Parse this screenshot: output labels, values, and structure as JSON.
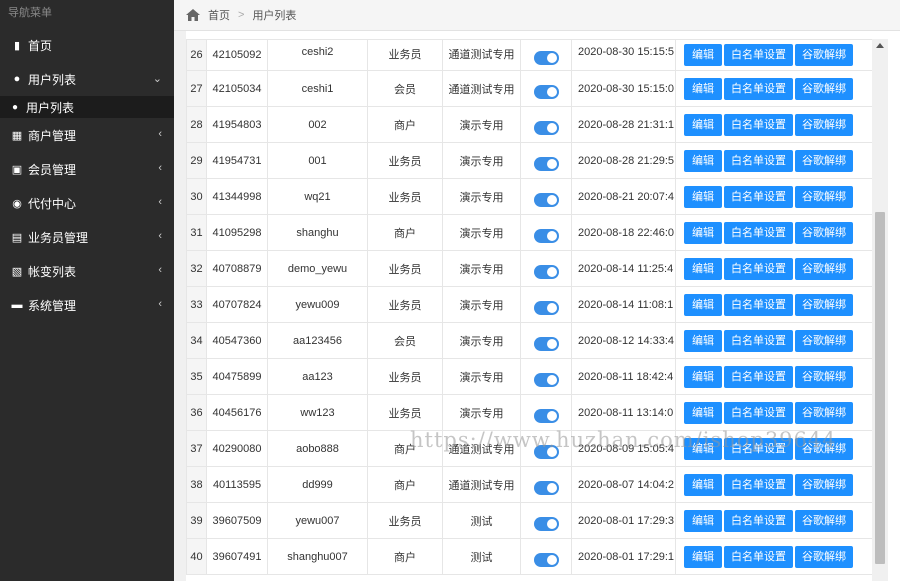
{
  "sidebar": {
    "heading": "导航菜单",
    "items": [
      {
        "label": "首页",
        "icon": "chart-icon",
        "glyph": "▮",
        "arrow": ""
      },
      {
        "label": "用户列表",
        "icon": "user-icon",
        "glyph": "●",
        "arrow": "⌄"
      },
      {
        "label": "商户管理",
        "icon": "bank-icon",
        "glyph": "▦",
        "arrow": "‹"
      },
      {
        "label": "会员管理",
        "icon": "member-card-icon",
        "glyph": "▣",
        "arrow": "‹"
      },
      {
        "label": "代付中心",
        "icon": "circle-icon",
        "glyph": "◉",
        "arrow": "‹"
      },
      {
        "label": "业务员管理",
        "icon": "id-card-icon",
        "glyph": "▤",
        "arrow": "‹"
      },
      {
        "label": "帐变列表",
        "icon": "ledger-icon",
        "glyph": "▧",
        "arrow": "‹"
      },
      {
        "label": "系统管理",
        "icon": "credit-card-icon",
        "glyph": "▬",
        "arrow": "‹"
      }
    ],
    "sub_item": {
      "label": "用户列表",
      "icon": "user-icon",
      "glyph": "●"
    }
  },
  "breadcrumb": {
    "home": "首页",
    "current": "用户列表",
    "sep": ">"
  },
  "table": {
    "buttons": {
      "edit": "编辑",
      "whitelist": "白名单设置",
      "google": "谷歌解绑"
    },
    "switch_color": "#3a8ee6",
    "rows": [
      {
        "idx": "26",
        "id": "42105092",
        "name": "ceshi2",
        "role": "业务员",
        "note": "通道测试专用",
        "time": "2020-08-30 15:15:5",
        "enabled": true
      },
      {
        "idx": "27",
        "id": "42105034",
        "name": "ceshi1",
        "role": "会员",
        "note": "通道测试专用",
        "time": "2020-08-30 15:15:0",
        "enabled": true
      },
      {
        "idx": "28",
        "id": "41954803",
        "name": "002",
        "role": "商户",
        "note": "演示专用",
        "time": "2020-08-28 21:31:1",
        "enabled": true
      },
      {
        "idx": "29",
        "id": "41954731",
        "name": "001",
        "role": "业务员",
        "note": "演示专用",
        "time": "2020-08-28 21:29:5",
        "enabled": true
      },
      {
        "idx": "30",
        "id": "41344998",
        "name": "wq21",
        "role": "业务员",
        "note": "演示专用",
        "time": "2020-08-21 20:07:4",
        "enabled": true
      },
      {
        "idx": "31",
        "id": "41095298",
        "name": "shanghu",
        "role": "商户",
        "note": "演示专用",
        "time": "2020-08-18 22:46:0",
        "enabled": true
      },
      {
        "idx": "32",
        "id": "40708879",
        "name": "demo_yewu",
        "role": "业务员",
        "note": "演示专用",
        "time": "2020-08-14 11:25:4",
        "enabled": true
      },
      {
        "idx": "33",
        "id": "40707824",
        "name": "yewu009",
        "role": "业务员",
        "note": "演示专用",
        "time": "2020-08-14 11:08:1",
        "enabled": true
      },
      {
        "idx": "34",
        "id": "40547360",
        "name": "aa123456",
        "role": "会员",
        "note": "演示专用",
        "time": "2020-08-12 14:33:4",
        "enabled": true
      },
      {
        "idx": "35",
        "id": "40475899",
        "name": "aa123",
        "role": "业务员",
        "note": "演示专用",
        "time": "2020-08-11 18:42:4",
        "enabled": true
      },
      {
        "idx": "36",
        "id": "40456176",
        "name": "ww123",
        "role": "业务员",
        "note": "演示专用",
        "time": "2020-08-11 13:14:0",
        "enabled": true
      },
      {
        "idx": "37",
        "id": "40290080",
        "name": "aobo888",
        "role": "商户",
        "note": "通道测试专用",
        "time": "2020-08-09 15:05:4",
        "enabled": true
      },
      {
        "idx": "38",
        "id": "40113595",
        "name": "dd999",
        "role": "商户",
        "note": "通道测试专用",
        "time": "2020-08-07 14:04:2",
        "enabled": true
      },
      {
        "idx": "39",
        "id": "39607509",
        "name": "yewu007",
        "role": "业务员",
        "note": "测试",
        "time": "2020-08-01 17:29:3",
        "enabled": true
      },
      {
        "idx": "40",
        "id": "39607491",
        "name": "shanghu007",
        "role": "商户",
        "note": "测试",
        "time": "2020-08-01 17:29:1",
        "enabled": true
      }
    ]
  },
  "watermark": "https://www.huzhan.com/ishop39644"
}
